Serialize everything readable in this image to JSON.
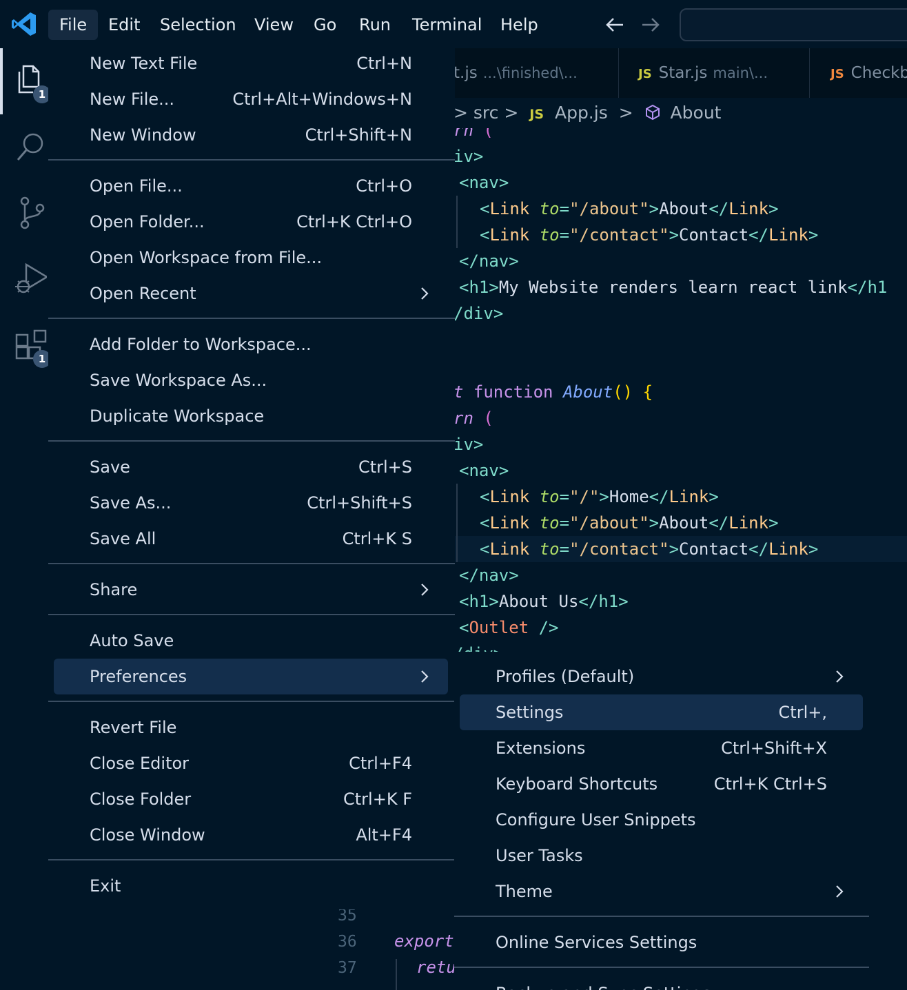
{
  "menubar": {
    "items": [
      "File",
      "Edit",
      "Selection",
      "View",
      "Go",
      "Run",
      "Terminal",
      "Help"
    ]
  },
  "activity": {
    "explorer_badge": "1",
    "extensions_badge": "1"
  },
  "tabs": [
    {
      "name": "t.js",
      "desc": "...\\finished\\...",
      "icon": ""
    },
    {
      "name": "Star.js",
      "desc": "main\\...",
      "icon": "JS"
    },
    {
      "name": "Checkb",
      "desc": "",
      "icon": "JS"
    }
  ],
  "breadcrumb": {
    "lead": "> src >",
    "icon": "JS",
    "file": "App.js",
    "sep": ">",
    "symbol": "About"
  },
  "file_menu": {
    "items": [
      {
        "label": "New Text File",
        "shortcut": "Ctrl+N"
      },
      {
        "label": "New File...",
        "shortcut": "Ctrl+Alt+Windows+N"
      },
      {
        "label": "New Window",
        "shortcut": "Ctrl+Shift+N"
      },
      {
        "label": "Open File...",
        "shortcut": "Ctrl+O"
      },
      {
        "label": "Open Folder...",
        "shortcut": "Ctrl+K Ctrl+O"
      },
      {
        "label": "Open Workspace from File...",
        "shortcut": ""
      },
      {
        "label": "Open Recent",
        "shortcut": ""
      },
      {
        "label": "Add Folder to Workspace...",
        "shortcut": ""
      },
      {
        "label": "Save Workspace As...",
        "shortcut": ""
      },
      {
        "label": "Duplicate Workspace",
        "shortcut": ""
      },
      {
        "label": "Save",
        "shortcut": "Ctrl+S"
      },
      {
        "label": "Save As...",
        "shortcut": "Ctrl+Shift+S"
      },
      {
        "label": "Save All",
        "shortcut": "Ctrl+K S"
      },
      {
        "label": "Share",
        "shortcut": ""
      },
      {
        "label": "Auto Save",
        "shortcut": ""
      },
      {
        "label": "Preferences",
        "shortcut": ""
      },
      {
        "label": "Revert File",
        "shortcut": ""
      },
      {
        "label": "Close Editor",
        "shortcut": "Ctrl+F4"
      },
      {
        "label": "Close Folder",
        "shortcut": "Ctrl+K F"
      },
      {
        "label": "Close Window",
        "shortcut": "Alt+F4"
      },
      {
        "label": "Exit",
        "shortcut": ""
      }
    ]
  },
  "pref_menu": {
    "items": [
      {
        "label": "Profiles (Default)",
        "shortcut": ""
      },
      {
        "label": "Settings",
        "shortcut": "Ctrl+,"
      },
      {
        "label": "Extensions",
        "shortcut": "Ctrl+Shift+X"
      },
      {
        "label": "Keyboard Shortcuts",
        "shortcut": "Ctrl+K Ctrl+S"
      },
      {
        "label": "Configure User Snippets",
        "shortcut": ""
      },
      {
        "label": "User Tasks",
        "shortcut": ""
      },
      {
        "label": "Theme",
        "shortcut": ""
      },
      {
        "label": "Online Services Settings",
        "shortcut": ""
      },
      {
        "label": "Backup and Sync Settings...",
        "shortcut": ""
      }
    ]
  },
  "code": {
    "l1": [
      "rn",
      " ("
    ],
    "l2": [
      "iv",
      ">"
    ],
    "l3": [
      "<",
      "nav",
      ">"
    ],
    "l4": [
      "<",
      "Link",
      " ",
      "to",
      "=",
      "\"/about\"",
      ">",
      "About",
      "</",
      "Link",
      ">"
    ],
    "l5": [
      "<",
      "Link",
      " ",
      "to",
      "=",
      "\"/contact\"",
      ">",
      "Contact",
      "</",
      "Link",
      ">"
    ],
    "l6": [
      "</",
      "nav",
      ">"
    ],
    "l7": [
      "<",
      "h1",
      ">",
      "My Website renders learn react link",
      "</h1"
    ],
    "l8": [
      "/",
      "div",
      ">"
    ],
    "l10": [
      "t",
      " ",
      "function",
      " ",
      "About",
      "()",
      " ",
      "{"
    ],
    "l11": [
      "rn",
      " ("
    ],
    "l12": [
      "iv",
      ">"
    ],
    "l13": [
      "<",
      "nav",
      ">"
    ],
    "l14": [
      "<",
      "Link",
      " ",
      "to",
      "=",
      "\"/\"",
      ">",
      "Home",
      "</",
      "Link",
      ">"
    ],
    "l15": [
      "<",
      "Link",
      " ",
      "to",
      "=",
      "\"/about\"",
      ">",
      "About",
      "</",
      "Link",
      ">"
    ],
    "l16": [
      "<",
      "Link",
      " ",
      "to",
      "=",
      "\"/contact\"",
      ">",
      "Contact",
      "</",
      "Link",
      ">"
    ],
    "l17": [
      "</",
      "nav",
      ">"
    ],
    "l18": [
      "<",
      "h1",
      ">",
      "About Us",
      "</",
      "h1",
      ">"
    ],
    "l19": [
      "<",
      "Outlet",
      " />"
    ],
    "l20": [
      "/div>"
    ],
    "gutter": [
      "35",
      "36",
      "37"
    ],
    "bottom1": "export",
    "bottom2": "retu"
  },
  "colors": {
    "background": "#011627",
    "highlight": "#132e4c",
    "js_icon": "#cbcb41",
    "js_icon_orange": "#f0883e"
  }
}
